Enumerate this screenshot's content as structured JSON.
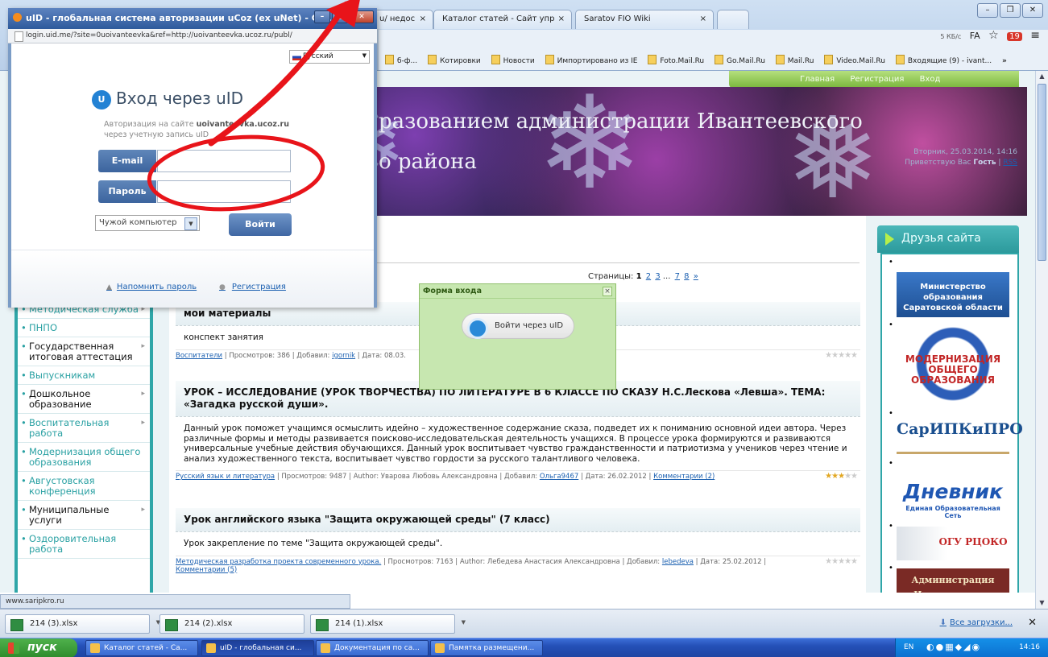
{
  "browser": {
    "tabs": [
      {
        "label": "u/ недос"
      },
      {
        "label": "Каталог статей - Сайт упр"
      },
      {
        "label": "Saratov FIO Wiki"
      }
    ],
    "tab_close_glyph": "×",
    "bookmarks": [
      "б-ф...",
      "Котировки",
      "Новости",
      "Импортировано из IE",
      "Foto.Mail.Ru",
      "Go.Mail.Ru",
      "Mail.Ru",
      "Video.Mail.Ru",
      "Входящие (9) - ivant..."
    ],
    "bookmarks_more": "»",
    "window_buttons": [
      "–",
      "❐",
      "✕"
    ],
    "speed_badge": "5 КБ/с",
    "translate_icon": "FA",
    "notif_count": "19",
    "menu_icon": "≡"
  },
  "site": {
    "topmenu": [
      "Главная",
      "Регистрация",
      "Вход"
    ],
    "banner_line1": "разованием администрации    Ивантеевского",
    "banner_line2": "о района",
    "banner_date": "Вторник, 25.03.2014, 14:16",
    "banner_greeting_prefix": "Приветствую Вас",
    "banner_guest": "Гость",
    "banner_rss": "RSS",
    "left_menu": [
      {
        "label": "Методическая служба",
        "dark": false,
        "arrow": true
      },
      {
        "label": "ПНПО",
        "dark": false,
        "arrow": false
      },
      {
        "label": "Государственная итоговая аттестация",
        "dark": true,
        "arrow": true
      },
      {
        "label": "Выпускникам",
        "dark": false,
        "arrow": false
      },
      {
        "label": "Дошкольное образование",
        "dark": true,
        "arrow": true
      },
      {
        "label": "Воспитательная работа",
        "dark": false,
        "arrow": true
      },
      {
        "label": "Модернизация общего образования",
        "dark": false,
        "arrow": false
      },
      {
        "label": "Августовская конференция",
        "dark": false,
        "arrow": false
      },
      {
        "label": "Муниципальные услуги",
        "dark": true,
        "arrow": true
      },
      {
        "label": "Оздоровительная работа",
        "dark": false,
        "arrow": false
      }
    ],
    "pages_label": "Страницы:",
    "pages": [
      "1",
      "2",
      "3",
      "...",
      "7",
      "8",
      "»"
    ],
    "entries": [
      {
        "title": "мои материалы",
        "body": "конспект занятия",
        "category": "Воспитатели",
        "views_label": "Просмотров:",
        "views": "386",
        "author_label": "",
        "author": "",
        "added_label": "Добавил:",
        "added": "igornik",
        "date_label": "Дата:",
        "date": "08.03.",
        "comments": "",
        "stars_on": 0
      },
      {
        "title": "УРОК – ИССЛЕДОВАНИЕ (УРОК ТВОРЧЕСТВА) ПО ЛИТЕРАТУРЕ В 6 КЛАССЕ ПО СКАЗУ Н.С.Лескова «Левша». ТЕМА: «Загадка русской души».",
        "body": "Данный урок поможет учащимся осмыслить идейно – художественное содержание сказа, подведет их к пониманию основной идеи автора. Через различные формы и методы развивается поисково-исследовательская деятельность учащихся. В процессе урока формируются и развиваются универсальные учебные действия обучающихся. Данный урок воспитывает чувство гражданственности и патриотизма у учеников через чтение и анализ художественного текста, воспитывает чувство гордости за русского талантливого человека.",
        "category": "Русский язык и литература",
        "views_label": "Просмотров:",
        "views": "9487",
        "author_label": "Author:",
        "author": "Уварова Любовь Александровна",
        "added_label": "Добавил:",
        "added": "Ольга9467",
        "date_label": "Дата:",
        "date": "26.02.2012",
        "comments": "Комментарии (2)",
        "stars_on": 3
      },
      {
        "title": "Урок английского языка \"Защита окружающей среды\" (7 класс)",
        "body": "Урок закрепление по теме \"Защита окружающей среды\".",
        "category": "Методическая разработка проекта современного урока.",
        "views_label": "Просмотров:",
        "views": "7163",
        "author_label": "Author:",
        "author": "Лебедева Анастасия Александровна",
        "added_label": "Добавил:",
        "added": "lebedeva",
        "date_label": "Дата:",
        "date": "25.02.2012",
        "comments": "Комментарии (5)",
        "stars_on": 0
      }
    ],
    "friends_title": "Друзья сайта",
    "partner_logos": {
      "l1": "Министерство образования Саратовской области",
      "l2": "МОДЕРНИЗАЦИЯ ОБЩЕГО ОБРАЗОВАНИЯ",
      "l3": "СарИПКиПРО",
      "l4": "Дневник",
      "l4_sub": "Единая Образовательная Сеть",
      "l5": "ОГУ РЦОКО",
      "l6": "Администрация Ивантеевского муниципального района"
    }
  },
  "login_window": {
    "title": "uID - глобальная система авторизации uCoz (ex uNet) - Go...",
    "url": "login.uid.me/?site=0uoivanteevka&ref=http://uoivanteevka.ucoz.ru/publ/",
    "language": "Русский",
    "heading": "Вход через uID",
    "logo_letter": "U",
    "subtitle_prefix": "Авторизация на сайте",
    "subtitle_site": "uoivanteevka.ucoz.ru",
    "subtitle_suffix": "через учетную запись uID",
    "email_label": "E-mail",
    "password_label": "Пароль",
    "computer_select": "Чужой компьютер",
    "login_button": "Войти",
    "remind_link": "Напомнить пароль",
    "register_link": "Регистрация",
    "window_buttons": [
      "–",
      "□",
      "✕"
    ]
  },
  "popup": {
    "title": "Форма входа",
    "close": "×",
    "button": "Войти через uID"
  },
  "annotation": {
    "color": "#e8141a"
  },
  "status_url": "www.saripkro.ru",
  "downloads": {
    "files": [
      "214 (3).xlsx",
      "214 (2).xlsx",
      "214 (1).xlsx"
    ],
    "all_label": "Все загрузки...",
    "close": "✕"
  },
  "taskbar": {
    "start": "пуск",
    "tasks": [
      "Каталог статей - Са...",
      "uID - глобальная си...",
      "Документация по са...",
      "Памятка размещени..."
    ],
    "lang": "EN",
    "clock": "14:16"
  }
}
